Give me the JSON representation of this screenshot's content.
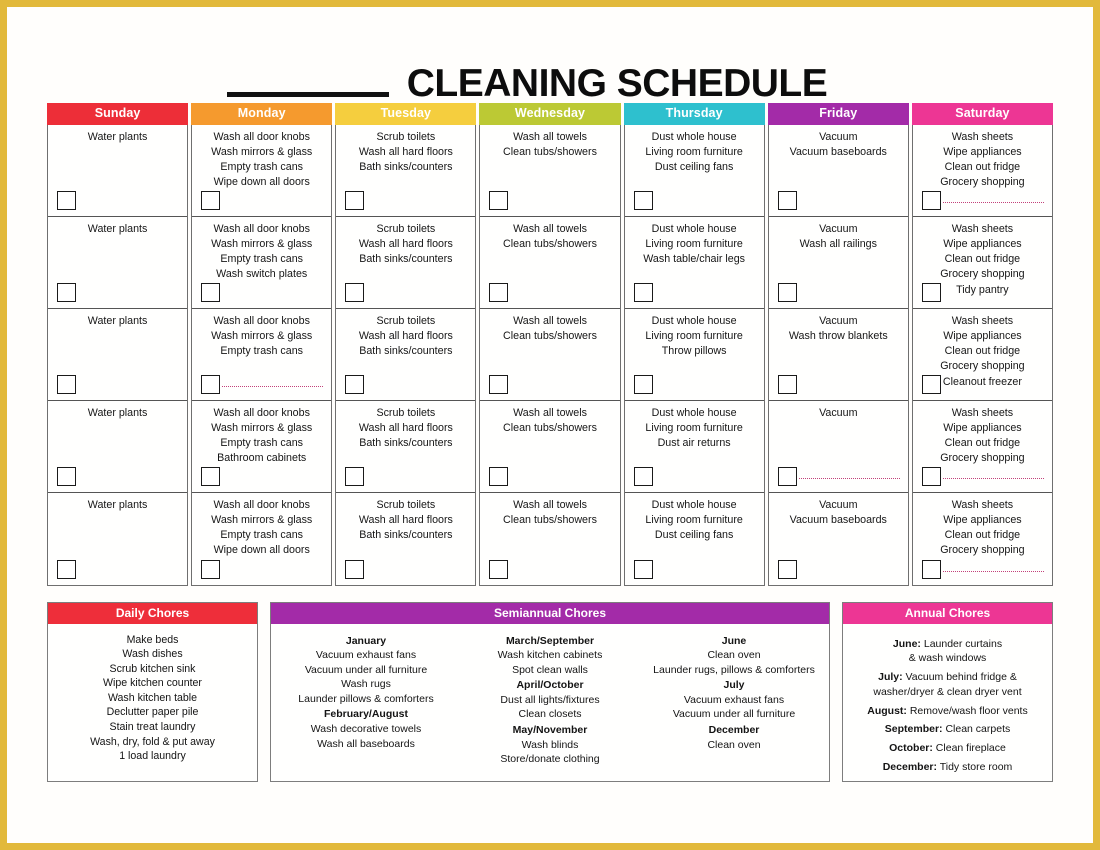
{
  "title": {
    "blank_label": "",
    "heading": "CLEANING SCHEDULE"
  },
  "colors": {
    "page_border": "#e2b93b",
    "sunday": "#ED2E38",
    "monday": "#F59A2E",
    "tuesday": "#F5CE3E",
    "wednesday": "#BCC934",
    "thursday": "#2EC0CE",
    "friday": "#A32BA8",
    "saturday": "#ED3694",
    "daily_header": "#EE2E3A",
    "semiannual_header": "#A32BA8",
    "annual_header": "#ED3694",
    "dotted_rule": "#c2417a"
  },
  "days": [
    {
      "name": "Sunday",
      "color_key": "sunday",
      "weeks": [
        {
          "tasks": [
            "Water plants"
          ],
          "dotted": false
        },
        {
          "tasks": [
            "Water plants"
          ],
          "dotted": false
        },
        {
          "tasks": [
            "Water plants"
          ],
          "dotted": false
        },
        {
          "tasks": [
            "Water plants"
          ],
          "dotted": false
        },
        {
          "tasks": [
            "Water plants"
          ],
          "dotted": false
        }
      ]
    },
    {
      "name": "Monday",
      "color_key": "monday",
      "weeks": [
        {
          "tasks": [
            "Wash all door knobs",
            "Wash mirrors & glass",
            "Empty trash cans",
            "Wipe down all doors"
          ],
          "dotted": false
        },
        {
          "tasks": [
            "Wash all door knobs",
            "Wash mirrors & glass",
            "Empty trash cans",
            "Wash switch plates"
          ],
          "dotted": false
        },
        {
          "tasks": [
            "Wash all door knobs",
            "Wash mirrors & glass",
            "Empty trash cans"
          ],
          "dotted": true
        },
        {
          "tasks": [
            "Wash all door knobs",
            "Wash mirrors & glass",
            "Empty trash cans",
            "Bathroom cabinets"
          ],
          "dotted": false
        },
        {
          "tasks": [
            "Wash all door knobs",
            "Wash mirrors & glass",
            "Empty trash cans",
            "Wipe down all doors"
          ],
          "dotted": false
        }
      ]
    },
    {
      "name": "Tuesday",
      "color_key": "tuesday",
      "weeks": [
        {
          "tasks": [
            "Scrub toilets",
            "Wash all hard floors",
            "Bath sinks/counters"
          ],
          "dotted": false
        },
        {
          "tasks": [
            "Scrub toilets",
            "Wash all hard floors",
            "Bath sinks/counters"
          ],
          "dotted": false
        },
        {
          "tasks": [
            "Scrub toilets",
            "Wash all hard floors",
            "Bath sinks/counters"
          ],
          "dotted": false
        },
        {
          "tasks": [
            "Scrub toilets",
            "Wash all hard floors",
            "Bath sinks/counters"
          ],
          "dotted": false
        },
        {
          "tasks": [
            "Scrub toilets",
            "Wash all hard floors",
            "Bath sinks/counters"
          ],
          "dotted": false
        }
      ]
    },
    {
      "name": "Wednesday",
      "color_key": "wednesday",
      "weeks": [
        {
          "tasks": [
            "Wash all towels",
            "Clean tubs/showers"
          ],
          "dotted": false
        },
        {
          "tasks": [
            "Wash all towels",
            "Clean tubs/showers"
          ],
          "dotted": false
        },
        {
          "tasks": [
            "Wash all towels",
            "Clean tubs/showers"
          ],
          "dotted": false
        },
        {
          "tasks": [
            "Wash all towels",
            "Clean tubs/showers"
          ],
          "dotted": false
        },
        {
          "tasks": [
            "Wash all towels",
            "Clean tubs/showers"
          ],
          "dotted": false
        }
      ]
    },
    {
      "name": "Thursday",
      "color_key": "thursday",
      "weeks": [
        {
          "tasks": [
            "Dust whole house",
            "Living room furniture",
            "Dust ceiling fans"
          ],
          "dotted": false
        },
        {
          "tasks": [
            "Dust whole house",
            "Living room furniture",
            "Wash table/chair legs"
          ],
          "dotted": false
        },
        {
          "tasks": [
            "Dust whole house",
            "Living room furniture",
            "Throw pillows"
          ],
          "dotted": false
        },
        {
          "tasks": [
            "Dust whole house",
            "Living room furniture",
            "Dust air returns"
          ],
          "dotted": false
        },
        {
          "tasks": [
            "Dust whole house",
            "Living room furniture",
            "Dust ceiling fans"
          ],
          "dotted": false
        }
      ]
    },
    {
      "name": "Friday",
      "color_key": "friday",
      "weeks": [
        {
          "tasks": [
            "Vacuum",
            "Vacuum baseboards"
          ],
          "dotted": false
        },
        {
          "tasks": [
            "Vacuum",
            "Wash all railings"
          ],
          "dotted": false
        },
        {
          "tasks": [
            "Vacuum",
            "Wash throw blankets"
          ],
          "dotted": false
        },
        {
          "tasks": [
            "Vacuum"
          ],
          "dotted": true
        },
        {
          "tasks": [
            "Vacuum",
            "Vacuum baseboards"
          ],
          "dotted": false
        }
      ]
    },
    {
      "name": "Saturday",
      "color_key": "saturday",
      "weeks": [
        {
          "tasks": [
            "Wash sheets",
            "Wipe appliances",
            "Clean out fridge",
            "Grocery shopping"
          ],
          "dotted": true
        },
        {
          "tasks": [
            "Wash sheets",
            "Wipe appliances",
            "Clean out fridge",
            "Grocery shopping",
            "Tidy pantry"
          ],
          "dotted": false
        },
        {
          "tasks": [
            "Wash sheets",
            "Wipe appliances",
            "Clean out fridge",
            "Grocery shopping",
            "Cleanout freezer"
          ],
          "dotted": false
        },
        {
          "tasks": [
            "Wash sheets",
            "Wipe appliances",
            "Clean out fridge",
            "Grocery shopping"
          ],
          "dotted": true
        },
        {
          "tasks": [
            "Wash sheets",
            "Wipe appliances",
            "Clean out fridge",
            "Grocery shopping"
          ],
          "dotted": true
        }
      ]
    }
  ],
  "daily": {
    "header": "Daily Chores",
    "items": [
      "Make beds",
      "Wash dishes",
      "Scrub kitchen sink",
      "Wipe kitchen counter",
      "Wash kitchen table",
      "Declutter paper pile",
      "Stain treat laundry",
      "Wash, dry, fold & put away",
      "1 load laundry"
    ]
  },
  "semiannual": {
    "header": "Semiannual Chores",
    "columns": [
      {
        "groups": [
          {
            "month": "January",
            "items": [
              "Vacuum exhaust fans",
              "Vacuum under all furniture",
              "Wash rugs",
              "Launder pillows & comforters"
            ]
          },
          {
            "month": "February/August",
            "items": [
              "Wash decorative towels",
              "Wash all baseboards"
            ]
          }
        ]
      },
      {
        "groups": [
          {
            "month": "March/September",
            "items": [
              "Wash kitchen cabinets",
              "Spot clean walls"
            ]
          },
          {
            "month": "April/October",
            "items": [
              "Dust all lights/fixtures",
              "Clean closets"
            ]
          },
          {
            "month": "May/November",
            "items": [
              "Wash blinds",
              "Store/donate clothing"
            ]
          }
        ]
      },
      {
        "groups": [
          {
            "month": "June",
            "items": [
              "Clean oven",
              "Launder rugs, pillows & comforters"
            ]
          },
          {
            "month": "July",
            "items": [
              "Vacuum exhaust fans",
              "Vacuum under all furniture"
            ]
          },
          {
            "month": "December",
            "items": [
              "Clean oven"
            ]
          }
        ]
      }
    ]
  },
  "annual": {
    "header": "Annual Chores",
    "entries": [
      {
        "month": "June:",
        "text": " Launder curtains",
        "cont": "& wash windows"
      },
      {
        "month": "July:",
        "text": " Vacuum behind fridge &",
        "cont": "washer/dryer & clean dryer vent"
      },
      {
        "month": "August:",
        "text": " Remove/wash floor vents",
        "cont": ""
      },
      {
        "month": "September:",
        "text": " Clean carpets",
        "cont": ""
      },
      {
        "month": "October:",
        "text": " Clean fireplace",
        "cont": ""
      },
      {
        "month": "December:",
        "text": " Tidy store room",
        "cont": ""
      }
    ]
  }
}
